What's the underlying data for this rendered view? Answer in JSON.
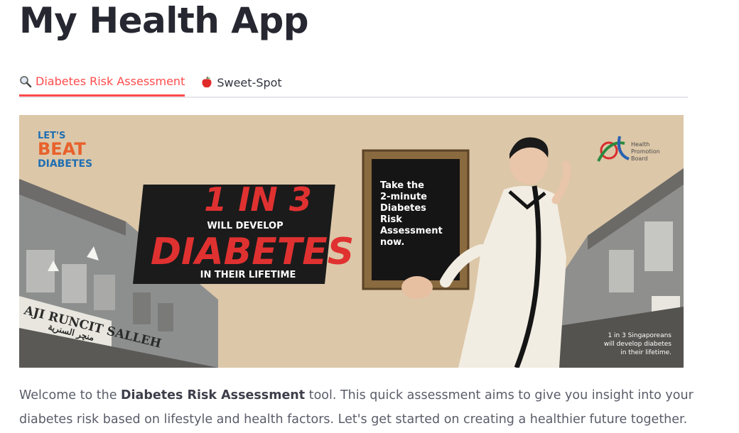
{
  "header": {
    "title": "My Health App"
  },
  "tabs": [
    {
      "label": "Diabetes Risk Assessment",
      "icon": "magnifier-icon",
      "active": true
    },
    {
      "label": "Sweet-Spot",
      "icon": "apple-icon",
      "active": false
    }
  ],
  "banner": {
    "campaign_logo": [
      "LET'S",
      "BEAT",
      "DIABETES"
    ],
    "headline_top": "1 IN 3",
    "headline_mid": "WILL DEVELOP",
    "headline_main": "DIABETES",
    "headline_sub": "IN THEIR LIFETIME",
    "board_lines": [
      "Take the",
      "2-minute",
      "Diabetes",
      "Risk",
      "Assessment",
      "now."
    ],
    "hpb_logo": [
      "Health",
      "Promotion",
      "Board"
    ],
    "shop_sign": [
      "AJI RUNCIT SALLEH",
      "منچر السنرية"
    ],
    "footnote": [
      "1 in 3 Singaporeans",
      "will develop diabetes",
      "in their lifetime."
    ],
    "colors": {
      "background": "#d9c3a3",
      "headline_red": "#d62828",
      "board": "#1c1c1c"
    }
  },
  "intro": {
    "before": "Welcome to the ",
    "bold": "Diabetes Risk Assessment",
    "after": " tool. This quick assessment aims to give you insight into your diabetes risk based on lifestyle and health factors. Let's get started on creating a healthier future together."
  },
  "colors": {
    "accent": "#ff4b4b",
    "text": "#31333f"
  }
}
